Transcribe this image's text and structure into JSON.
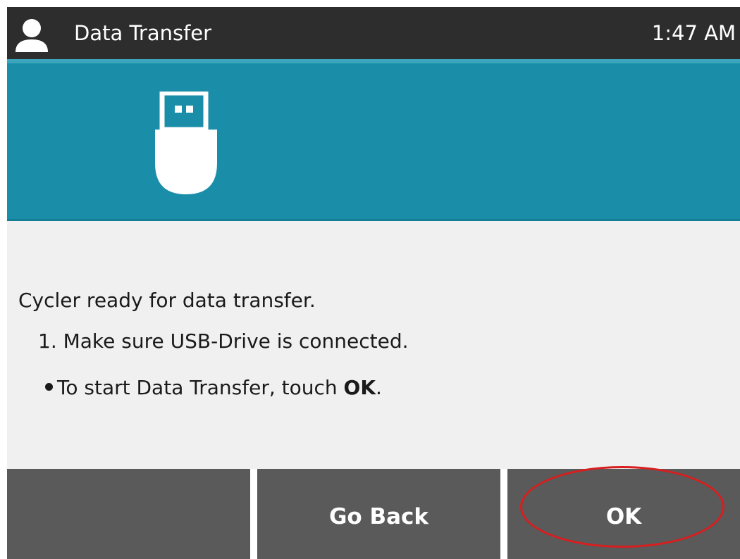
{
  "topbar": {
    "title": "Data Transfer",
    "time": "1:47 AM",
    "user_icon": "user-icon"
  },
  "banner": {
    "icon": "usb-drive-icon",
    "color": "#1a8ea8"
  },
  "message": {
    "main": "Cycler ready for data transfer.",
    "step": "1. Make sure USB-Drive is connected.",
    "bullet_prefix": "To start Data Transfer, touch ",
    "bullet_bold": "OK",
    "bullet_suffix": "."
  },
  "buttons": {
    "left": "",
    "go_back": "Go Back",
    "ok": "OK"
  },
  "highlight": {
    "color": "#d81e1e",
    "target": "ok-button"
  }
}
